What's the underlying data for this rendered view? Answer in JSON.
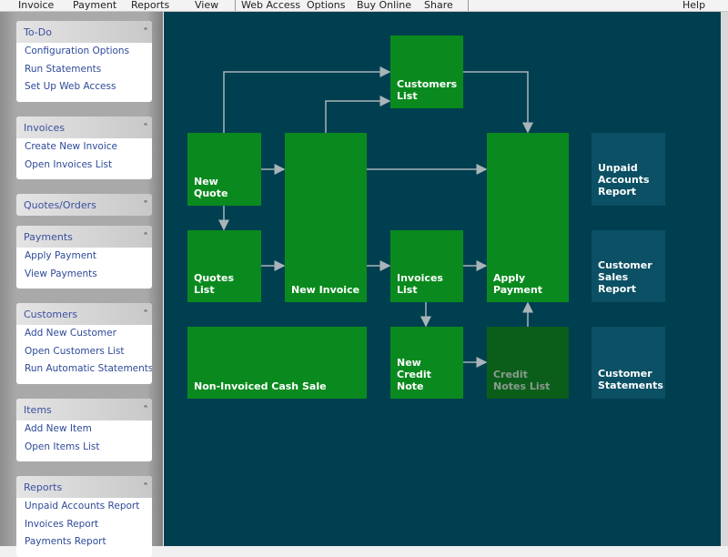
{
  "menu": [
    "Invoice",
    "Payment",
    "Reports",
    "View",
    "Web Access",
    "Options",
    "Buy Online",
    "Share",
    "Help"
  ],
  "sidebar": [
    {
      "title": "To-Do",
      "state": "expanded",
      "items": [
        "Configuration Options",
        "Run Statements",
        "Set Up Web Access"
      ]
    },
    {
      "title": "Invoices",
      "state": "expanded",
      "items": [
        "Create New Invoice",
        "Open Invoices List"
      ]
    },
    {
      "title": "Quotes/Orders",
      "state": "collapsed",
      "items": []
    },
    {
      "title": "Payments",
      "state": "expanded",
      "items": [
        "Apply Payment",
        "View Payments"
      ]
    },
    {
      "title": "Customers",
      "state": "expanded",
      "items": [
        "Add New Customer",
        "Open Customers List",
        "Run Automatic Statements"
      ]
    },
    {
      "title": "Items",
      "state": "expanded",
      "items": [
        "Add New Item",
        "Open Items List"
      ]
    },
    {
      "title": "Reports",
      "state": "expanded",
      "items": [
        "Unpaid Accounts Report",
        "Invoices Report",
        "Payments Report"
      ]
    }
  ],
  "flow": {
    "customers_list": "Customers List",
    "new_quote": "New Quote",
    "new_invoice": "New Invoice",
    "apply_payment": "Apply Payment",
    "unpaid_accounts_report": "Unpaid Accounts Report",
    "quotes_list": "Quotes List",
    "invoices_list": "Invoices List",
    "customer_sales_report": "Customer Sales Report",
    "cash_sale": "Non-Invoiced Cash Sale",
    "new_credit_note": "New Credit Note",
    "credit_notes_list": "Credit Notes List",
    "customer_statements": "Customer Statements"
  },
  "colors": {
    "background": "#003f50",
    "flow_green": "#0a8a1e",
    "report_teal": "#0b5064",
    "disabled_green": "#0b5e1a"
  }
}
